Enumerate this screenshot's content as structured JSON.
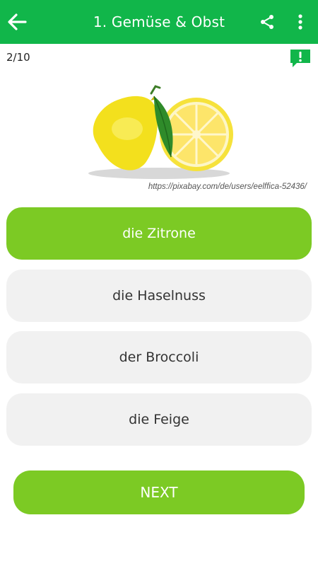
{
  "header": {
    "title": "1. Gemüse & Obst",
    "back_icon": "arrow-left-icon",
    "share_icon": "share-icon",
    "more_icon": "more-vertical-icon"
  },
  "quiz": {
    "progress": "2/10",
    "report_icon": "feedback-exclamation-icon",
    "image_alt": "lemon",
    "image_credit": "https://pixabay.com/de/users/eelffica-52436/",
    "answers": [
      {
        "label": "die Zitrone",
        "state": "correct"
      },
      {
        "label": "die Haselnuss",
        "state": "default"
      },
      {
        "label": "der Broccoli",
        "state": "default"
      },
      {
        "label": "die Feige",
        "state": "default"
      }
    ],
    "next_label": "NEXT"
  },
  "colors": {
    "appbar": "#11b64a",
    "accent": "#7cca24",
    "answer_bg": "#f1f1f1"
  }
}
